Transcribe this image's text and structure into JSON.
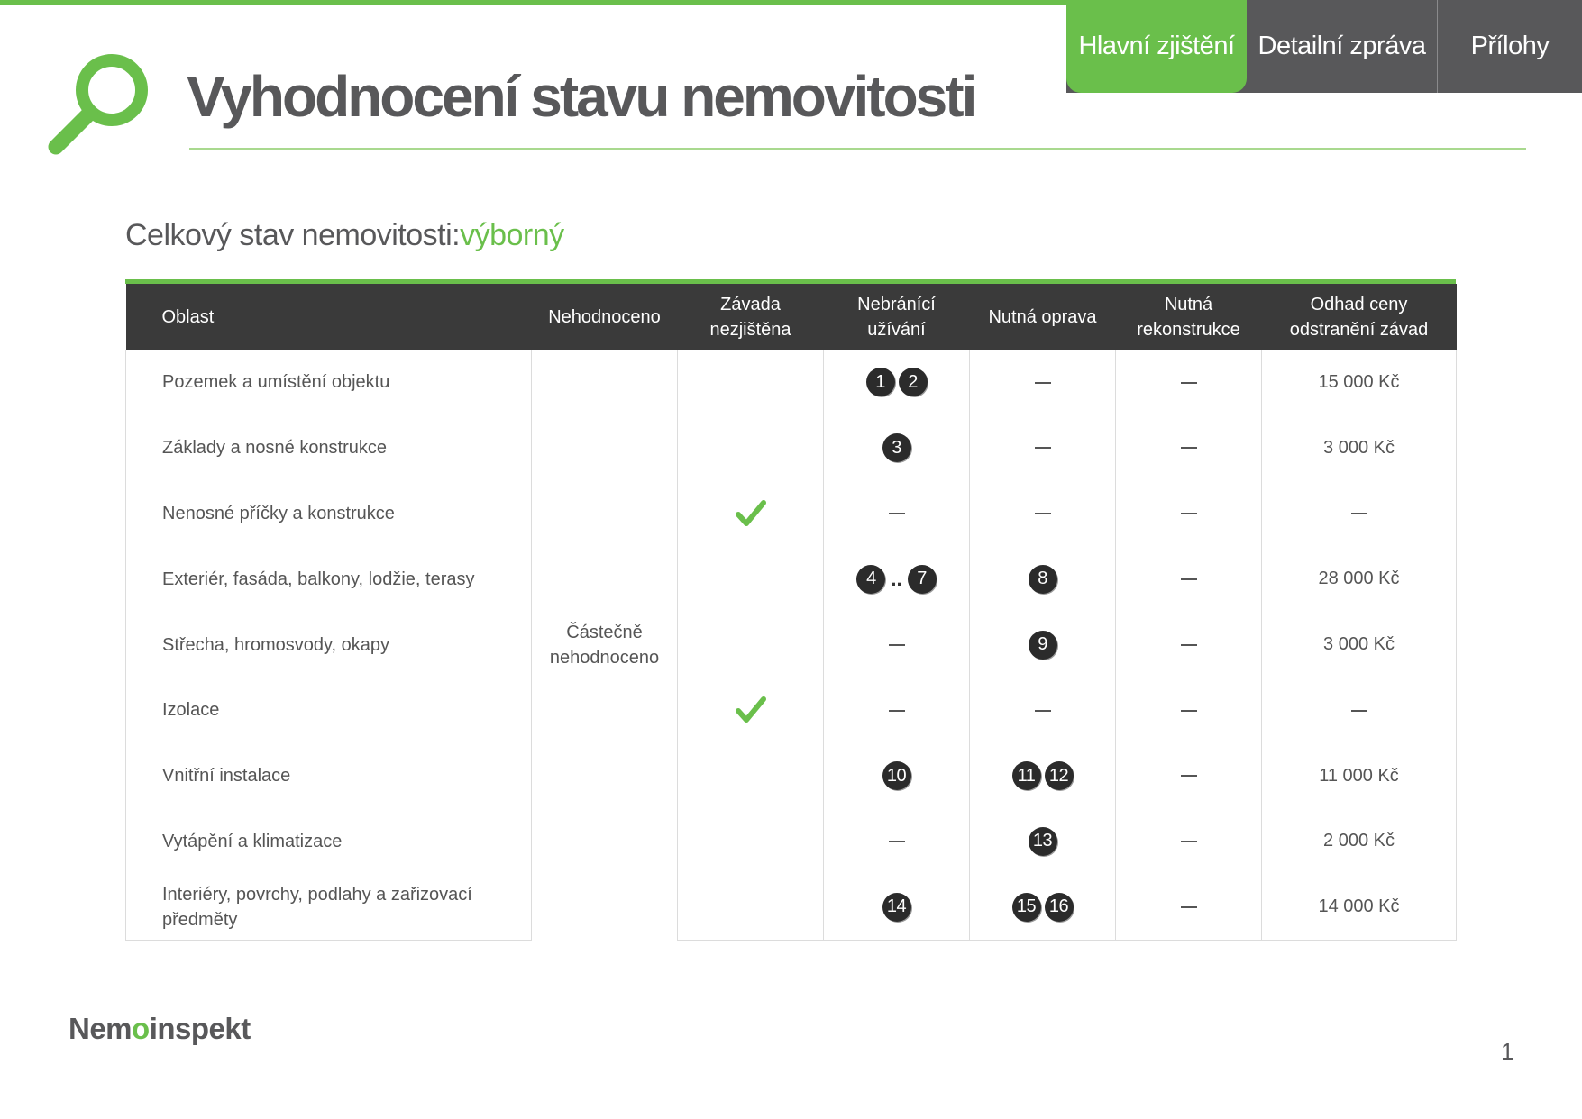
{
  "header": {
    "title": "Vyhodnocení stavu nemovitosti",
    "tabs": [
      {
        "label": "Hlavní zjištění",
        "active": true
      },
      {
        "label": "Detailní zpráva",
        "active": false
      },
      {
        "label": "Přílohy",
        "active": false
      }
    ]
  },
  "summary": {
    "label": "Celkový stav nemovitosti:",
    "value": "výborný"
  },
  "table": {
    "columns": [
      "Oblast",
      "Nehodnoceno",
      "Závada nezjištěna",
      "Nebránící užívání",
      "Nutná oprava",
      "Nutná rekonstrukce",
      "Odhad ceny odstranění závad"
    ],
    "merged_not_evaluated": "Částečně nehodnoceno",
    "rows": [
      {
        "area": "Pozemek a umístění objektu",
        "no_defect": false,
        "not_hindering": [
          "1",
          "2"
        ],
        "repair": [],
        "reconstruction": [],
        "cost": "15 000 Kč"
      },
      {
        "area": "Základy a nosné konstrukce",
        "no_defect": false,
        "not_hindering": [
          "3"
        ],
        "repair": [],
        "reconstruction": [],
        "cost": "3 000 Kč"
      },
      {
        "area": "Nenosné příčky a konstrukce",
        "no_defect": true,
        "not_hindering": [],
        "repair": [],
        "reconstruction": [],
        "cost": ""
      },
      {
        "area": "Exteriér, fasáda, balkony, lodžie, terasy",
        "no_defect": false,
        "not_hindering": [
          "4",
          "..",
          "7"
        ],
        "repair": [
          "8"
        ],
        "reconstruction": [],
        "cost": "28 000 Kč"
      },
      {
        "area": "Střecha, hromosvody, okapy",
        "no_defect": false,
        "not_hindering": [],
        "repair": [
          "9"
        ],
        "reconstruction": [],
        "cost": "3 000 Kč"
      },
      {
        "area": "Izolace",
        "no_defect": true,
        "not_hindering": [],
        "repair": [],
        "reconstruction": [],
        "cost": ""
      },
      {
        "area": "Vnitřní instalace",
        "no_defect": false,
        "not_hindering": [
          "10"
        ],
        "repair": [
          "11",
          "12"
        ],
        "reconstruction": [],
        "cost": "11 000 Kč"
      },
      {
        "area": "Vytápění a klimatizace",
        "no_defect": false,
        "not_hindering": [],
        "repair": [
          "13"
        ],
        "reconstruction": [],
        "cost": "2 000 Kč"
      },
      {
        "area": "Interiéry, povrchy, podlahy a zařizovací předměty",
        "no_defect": false,
        "not_hindering": [
          "14"
        ],
        "repair": [
          "15",
          "16"
        ],
        "reconstruction": [],
        "cost": "14 000 Kč"
      }
    ]
  },
  "footer": {
    "logo_prefix": "Nem",
    "logo_o": "o",
    "logo_suffix": "inspekt",
    "page_number": "1"
  },
  "colors": {
    "accent": "#6abf4b",
    "dark": "#3a3a3a",
    "tab_gray": "#58585a"
  }
}
